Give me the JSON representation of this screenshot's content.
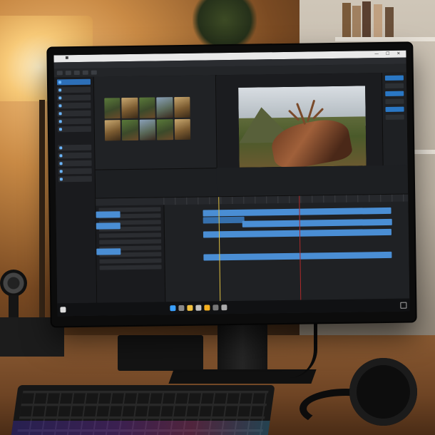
{
  "scene": {
    "colors": {
      "lamp": "#f7c977",
      "wall": "#b9afa0",
      "desk": "#6e4424",
      "clip_blue": "#4a8ed4",
      "accent_blue": "#2a77c4"
    }
  },
  "app": {
    "window_controls": "— ☐ ✕",
    "menu_items": [],
    "viewer_image": "stump-with-antlers-landscape"
  },
  "taskbar": {
    "clock_time": "",
    "clock_date": ""
  }
}
